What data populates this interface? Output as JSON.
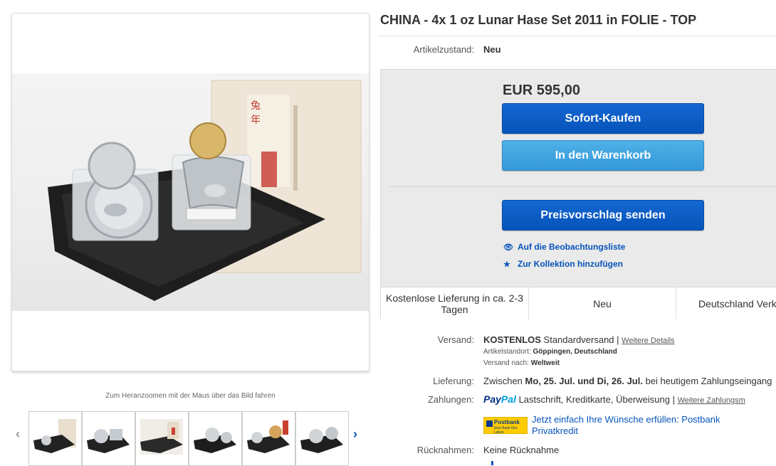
{
  "item": {
    "title": "CHINA - 4x 1 oz Lunar Hase Set 2011 in FOLIE - TOP",
    "condition_label": "Artikelzustand:",
    "condition_value": "Neu"
  },
  "gallery": {
    "zoom_hint": "Zum Heranzoomen mit der Maus über das Bild fahren",
    "thumb_count": 6,
    "prev_icon": "chevron-left-icon",
    "next_icon": "chevron-right-icon"
  },
  "buybox": {
    "price": "EUR 595,00",
    "buy_now": "Sofort-Kaufen",
    "add_to_cart": "In den Warenkorb",
    "make_offer": "Preisvorschlag senden",
    "watch": "Auf die Beobachtungsliste",
    "collection": "Zur Kollektion hinzufügen",
    "features": [
      "Kostenlose Lieferung in ca. 2-3 Tagen",
      "Neu",
      "Deutschland Verk"
    ]
  },
  "shipping": {
    "label": "Versand:",
    "cost": "KOSTENLOS",
    "method": "Standardversand |",
    "details_link": "Weitere Details",
    "location_label": "Artikelstandort:",
    "location_value": "Göppingen, Deutschland",
    "ships_to_label": "Versand nach:",
    "ships_to_value": "Weltweit"
  },
  "delivery": {
    "label": "Lieferung:",
    "prefix": "Zwischen",
    "dates": "Mo, 25. Jul. und Di, 26. Jul.",
    "suffix": "bei heutigem Zahlungseingang"
  },
  "payments": {
    "label": "Zahlungen:",
    "paypal_pay": "Pay",
    "paypal_pal": "Pal",
    "methods": "Lastschrift,  Kreditkarte,  Überweisung  |",
    "more_link": "Weitere Zahlungsm",
    "postbank_text": "Postbank",
    "postbank_sub": "Eine Bank fürs Leben",
    "postbank_promo_1": "Jetzt einfach Ihre Wünsche erfüllen: Postbank",
    "postbank_promo_2": "Privatkredit"
  },
  "returns": {
    "label": "Rücknahmen:",
    "value": "Keine Rücknahme"
  },
  "colors": {
    "primary_button": "#0654ba",
    "secondary_button": "#3498db",
    "paypal_dark": "#003087",
    "paypal_light": "#009cde",
    "postbank_yellow": "#ffcc00"
  }
}
